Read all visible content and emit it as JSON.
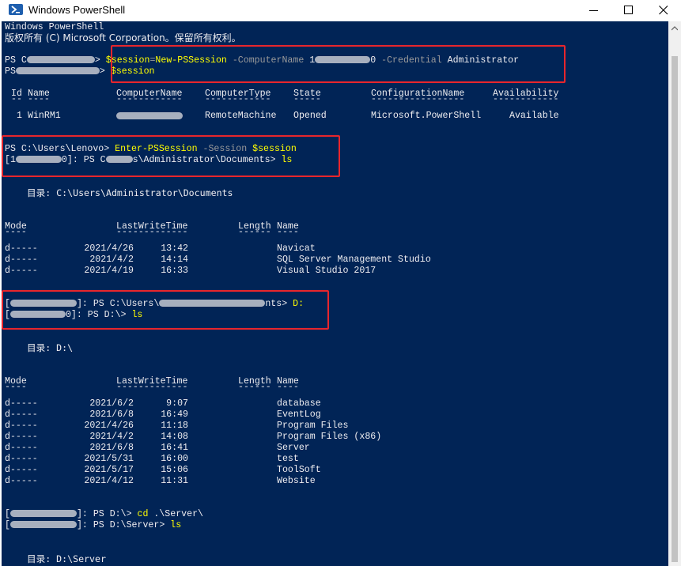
{
  "window": {
    "title": "Windows PowerShell",
    "icon": "powershell-icon",
    "controls": [
      "minimize-icon",
      "maximize-icon",
      "close-icon"
    ]
  },
  "colors": {
    "console_bg": "#012456",
    "text": "#eeedf0",
    "command": "#ffff00",
    "parameter": "#9a9a9a",
    "highlight_box": "#e8262c"
  },
  "header": {
    "line1": "Windows PowerShell",
    "line2": "版权所有 (C) Microsoft Corporation。保留所有权利。"
  },
  "block1": {
    "prompt_prefix": "PS C",
    "prompt_suffix": ">",
    "var1": "$session",
    "eq": "=",
    "cmd1": "New-PSSession",
    "param1": " -ComputerName ",
    "ip_start": "1",
    "ip_end": "0",
    "param2": " -Credential ",
    "arg2": "Administrator",
    "line2_prefix": "PS",
    "line2_suffix": ">",
    "var2": "$session"
  },
  "session_table": {
    "headers": [
      "Id",
      "Name",
      "ComputerName",
      "ComputerType",
      "State",
      "ConfigurationName",
      "Availability"
    ],
    "underlines": [
      "--",
      "----",
      "------------",
      "------------",
      "-----",
      "-----------------",
      "------------"
    ],
    "row": [
      "1",
      "WinRM1",
      "",
      "RemoteMachine",
      "Opened",
      "Microsoft.PowerShell",
      "Available"
    ]
  },
  "block2": {
    "prompt": "PS C:\\Users\\Lenovo>",
    "cmd": "Enter-PSSession",
    "param": " -Session ",
    "var": "$session",
    "remote_prompt_a": "[1",
    "remote_prompt_b": "0]: PS C",
    "remote_prompt_c": "s\\Administrator\\Documents>",
    "cmd2": "ls"
  },
  "dir1": {
    "label": "目录: C:\\Users\\Administrator\\Documents",
    "headers": [
      "Mode",
      "LastWriteTime",
      "Length",
      "Name"
    ],
    "underlines": [
      "----",
      "-------------",
      "------",
      "----"
    ],
    "rows": [
      {
        "mode": "d-----",
        "date": "2021/4/26",
        "time": "13:42",
        "name": "Navicat"
      },
      {
        "mode": "d-----",
        "date": "2021/4/2",
        "time": "14:14",
        "name": "SQL Server Management Studio"
      },
      {
        "mode": "d-----",
        "date": "2021/4/19",
        "time": "16:33",
        "name": "Visual Studio 2017"
      }
    ]
  },
  "block3": {
    "line1_a": "[",
    "line1_b": "]: PS C:\\Users\\",
    "line1_c": "nts>",
    "cmd1": "D:",
    "line2_a": "[",
    "line2_b": "0]: PS D:\\>",
    "cmd2": "ls"
  },
  "dir2": {
    "label": "目录: D:\\",
    "headers": [
      "Mode",
      "LastWriteTime",
      "Length",
      "Name"
    ],
    "underlines": [
      "----",
      "-------------",
      "------",
      "----"
    ],
    "rows": [
      {
        "mode": "d-----",
        "date": "2021/6/2",
        "time": "9:07",
        "name": "database"
      },
      {
        "mode": "d-----",
        "date": "2021/6/8",
        "time": "16:49",
        "name": "EventLog"
      },
      {
        "mode": "d-----",
        "date": "2021/4/26",
        "time": "11:18",
        "name": "Program Files"
      },
      {
        "mode": "d-----",
        "date": "2021/4/2",
        "time": "14:08",
        "name": "Program Files (x86)"
      },
      {
        "mode": "d-----",
        "date": "2021/6/8",
        "time": "16:41",
        "name": "Server"
      },
      {
        "mode": "d-----",
        "date": "2021/5/31",
        "time": "16:00",
        "name": "test"
      },
      {
        "mode": "d-----",
        "date": "2021/5/17",
        "time": "15:06",
        "name": "ToolSoft"
      },
      {
        "mode": "d-----",
        "date": "2021/4/12",
        "time": "11:31",
        "name": "Website"
      }
    ]
  },
  "block4": {
    "line1_a": "[",
    "line1_b": "]: PS D:\\>",
    "cmd1": "cd",
    "arg1": " .\\Server\\",
    "line2_a": "[",
    "line2_b": "]: PS D:\\Server>",
    "cmd2": "ls"
  },
  "dir3": {
    "label": "目录: D:\\Server"
  }
}
